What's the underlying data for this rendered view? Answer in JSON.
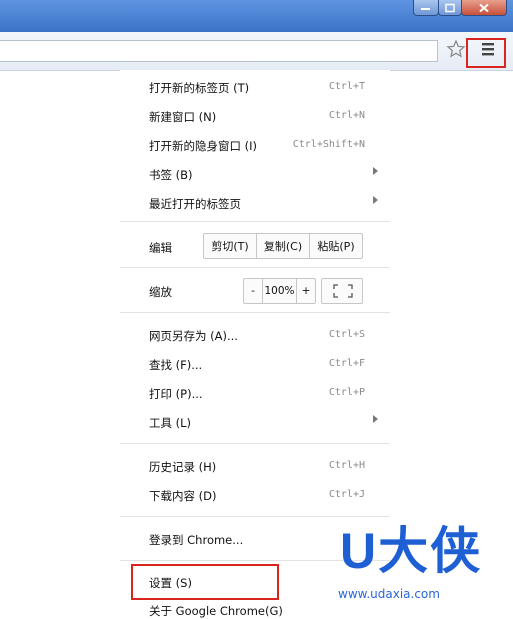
{
  "window": {
    "min_icon": "minimize-icon",
    "max_icon": "maximize-icon",
    "close_icon": "close-icon"
  },
  "toolbar": {
    "star_icon": "bookmark-star-icon",
    "menu_icon": "hamburger-menu-icon"
  },
  "colors": {
    "highlight_box": "#d9251d",
    "watermark": "#1f5fd4"
  },
  "menu": {
    "new_tab": {
      "label": "打开新的标签页 (T)",
      "shortcut": "Ctrl+T"
    },
    "new_window": {
      "label": "新建窗口 (N)",
      "shortcut": "Ctrl+N"
    },
    "incognito": {
      "label": "打开新的隐身窗口 (I)",
      "shortcut": "Ctrl+Shift+N"
    },
    "bookmarks": {
      "label": "书签 (B)"
    },
    "recent_tabs": {
      "label": "最近打开的标签页"
    },
    "edit": {
      "label": "编辑",
      "cut": "剪切(T)",
      "copy": "复制(C)",
      "paste": "粘贴(P)"
    },
    "zoom": {
      "label": "缩放",
      "minus": "-",
      "value": "100%",
      "plus": "+"
    },
    "save_as": {
      "label": "网页另存为 (A)...",
      "shortcut": "Ctrl+S"
    },
    "find": {
      "label": "查找 (F)...",
      "shortcut": "Ctrl+F"
    },
    "print": {
      "label": "打印 (P)...",
      "shortcut": "Ctrl+P"
    },
    "tools": {
      "label": "工具 (L)"
    },
    "history": {
      "label": "历史记录 (H)",
      "shortcut": "Ctrl+H"
    },
    "downloads": {
      "label": "下载内容 (D)",
      "shortcut": "Ctrl+J"
    },
    "signin": {
      "label": "登录到 Chrome..."
    },
    "settings": {
      "label": "设置 (S)"
    },
    "about": {
      "label": "关于 Google Chrome(G)"
    }
  },
  "watermark": {
    "brand": "U大侠",
    "url": "www.udaxia.com"
  }
}
